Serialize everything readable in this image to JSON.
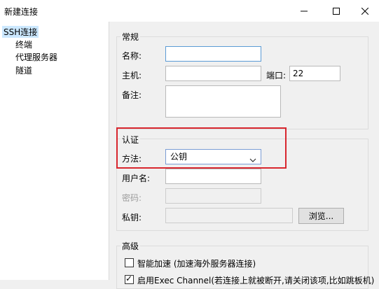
{
  "window": {
    "title": "新建连接",
    "minimize_icon": "minimize-icon",
    "maximize_icon": "maximize-icon",
    "close_icon": "close-icon"
  },
  "sidebar": {
    "items": [
      {
        "label": "SSH连接",
        "selected": true
      },
      {
        "label": "终端"
      },
      {
        "label": "代理服务器"
      },
      {
        "label": "隧道"
      }
    ]
  },
  "general": {
    "legend": "常规",
    "name_label": "名称:",
    "name_value": "",
    "host_label": "主机:",
    "host_value": "",
    "port_label": "端口:",
    "port_value": "22",
    "note_label": "备注:",
    "note_value": ""
  },
  "auth": {
    "legend": "认证",
    "method_label": "方法:",
    "method_value": "公钥",
    "username_label": "用户名:",
    "username_value": "",
    "password_label": "密码:",
    "password_value": "",
    "private_key_label": "私钥:",
    "private_key_value": "",
    "browse_label": "浏览...",
    "highlight_color": "#d8262e"
  },
  "advanced": {
    "legend": "高级",
    "smart_accel_label": "智能加速 (加速海外服务器连接)",
    "smart_accel_checked": false,
    "exec_channel_label": "启用Exec Channel(若连接上就被断开,请关闭该项,比如跳板机)",
    "exec_channel_checked": true
  }
}
